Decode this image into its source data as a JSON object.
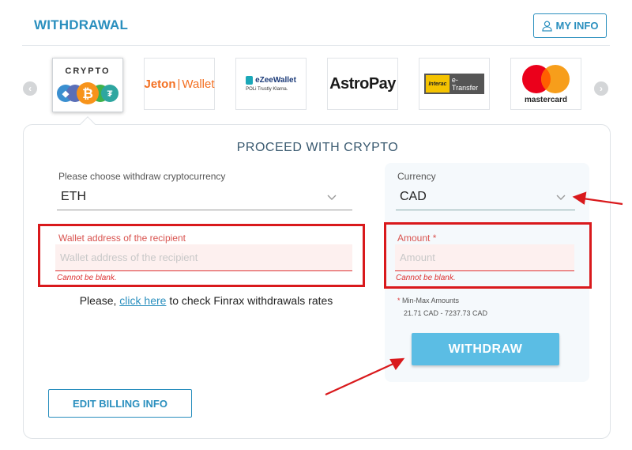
{
  "header": {
    "title": "WITHDRAWAL",
    "my_info_label": "MY INFO"
  },
  "methods": [
    {
      "name": "crypto",
      "label": "CRYPTO",
      "active": true
    },
    {
      "name": "jeton",
      "label_main": "Jeton",
      "label_sep": "|",
      "label_sub": "Wallet"
    },
    {
      "name": "ezeewallet",
      "label_main": "eZeeWallet",
      "label_sub": "POLi  Trustly  Klarna."
    },
    {
      "name": "astropay",
      "label": "AstroPay"
    },
    {
      "name": "interac",
      "label_logo": "Interac",
      "label_text": "e-Transfer"
    },
    {
      "name": "mastercard",
      "label": "mastercard"
    }
  ],
  "panel": {
    "title": "PROCEED WITH CRYPTO",
    "crypto_select": {
      "label": "Please choose withdraw cryptocurrency",
      "value": "ETH"
    },
    "currency_select": {
      "label": "Currency",
      "value": "CAD"
    },
    "wallet_field": {
      "label": "Wallet address of the recipient",
      "placeholder": "Wallet address of the recipient",
      "error": "Cannot be blank."
    },
    "amount_field": {
      "label": "Amount",
      "required_mark": "*",
      "placeholder": "Amount",
      "error": "Cannot be blank."
    },
    "rates": {
      "prefix": "Please, ",
      "link": "click here",
      "suffix": " to check Finrax withdrawals rates"
    },
    "limits": {
      "star": "*",
      "label": " Min-Max Amounts",
      "range": "21.71 CAD - 7237.73 CAD"
    },
    "withdraw_label": "WITHDRAW",
    "edit_billing_label": "EDIT BILLING INFO"
  },
  "colors": {
    "accent": "#2a8fbe",
    "button": "#5bbde4",
    "error": "#d33333",
    "annotation": "#d9191c"
  }
}
